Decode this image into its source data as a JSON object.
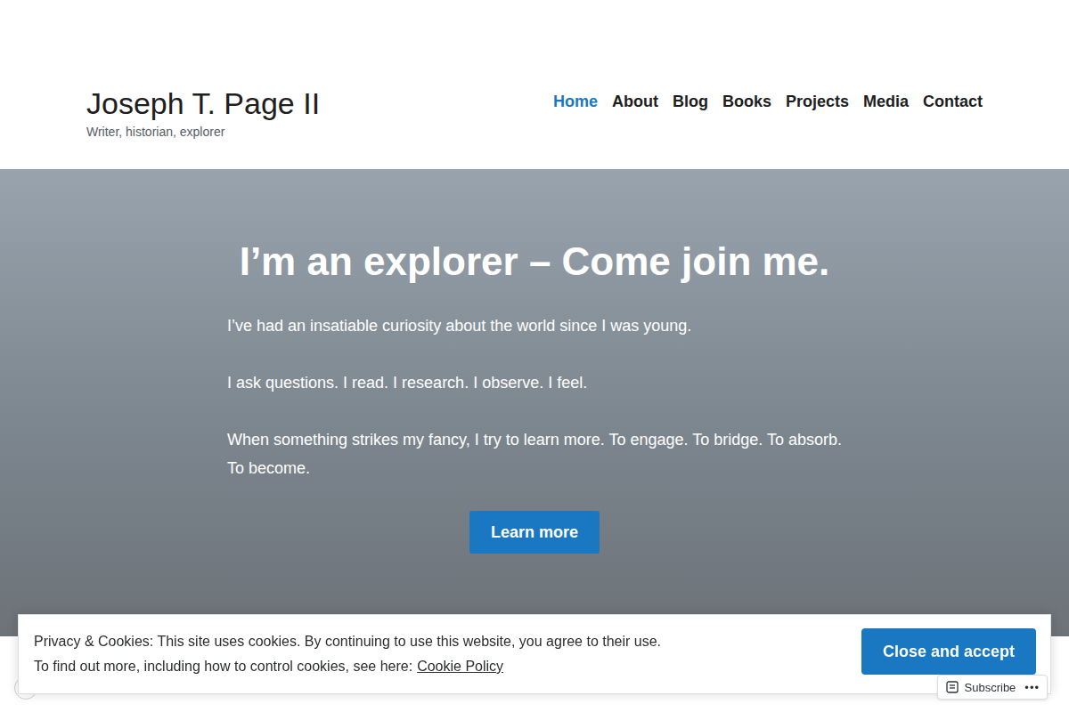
{
  "site": {
    "title": "Joseph T. Page II",
    "tagline": "Writer, historian, explorer"
  },
  "nav": [
    {
      "label": "Home",
      "selected": true
    },
    {
      "label": "About",
      "selected": false
    },
    {
      "label": "Blog",
      "selected": false
    },
    {
      "label": "Books",
      "selected": false
    },
    {
      "label": "Projects",
      "selected": false
    },
    {
      "label": "Media",
      "selected": false
    },
    {
      "label": "Contact",
      "selected": false
    }
  ],
  "hero": {
    "heading": "I’m an explorer – Come join me.",
    "paragraphs": [
      "I’ve had an insatiable curiosity about the world since I was young.",
      "I ask questions. I read. I research. I observe. I feel.",
      "When something strikes my fancy, I try to learn more. To engage. To bridge. To absorb. To become."
    ],
    "button": "Learn more"
  },
  "cookie_banner": {
    "text": "Privacy & Cookies: This site uses cookies. By continuing to use this website, you agree to their use.",
    "policy_prefix": "To find out more, including how to control cookies, see here:",
    "policy_link": "Cookie Policy",
    "button": "Close and accept"
  },
  "action_bar": {
    "subscribe": "Subscribe",
    "more": "•••"
  }
}
